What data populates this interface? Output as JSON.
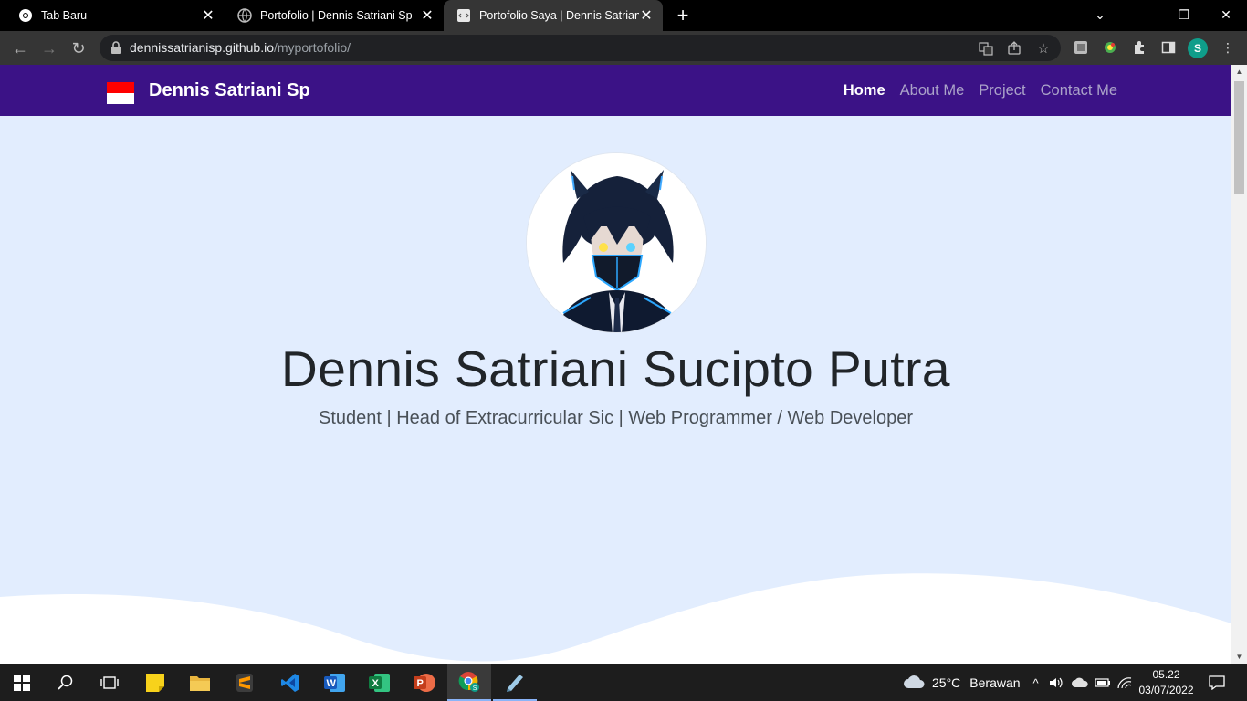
{
  "browser": {
    "tabs": [
      {
        "title": "Tab Baru",
        "icon": "chrome-icon",
        "active": false
      },
      {
        "title": "Portofolio | Dennis Satriani Sp",
        "icon": "globe-icon",
        "active": false
      },
      {
        "title": "Portofolio Saya | Dennis Satriani Sp",
        "icon": "page-icon",
        "active": true
      }
    ],
    "url_host": "dennissatrianisp.github.io",
    "url_path": "/myportofolio/",
    "profile_initial": "S"
  },
  "site": {
    "brand": "Dennis Satriani Sp",
    "nav": [
      {
        "label": "Home",
        "active": true
      },
      {
        "label": "About Me",
        "active": false
      },
      {
        "label": "Project",
        "active": false
      },
      {
        "label": "Contact Me",
        "active": false
      }
    ],
    "hero": {
      "name": "Dennis Satriani Sucipto Putra",
      "tagline": "Student | Head of Extracurricular Sic | Web Programmer / Web Developer"
    },
    "colors": {
      "navbar": "#3b1286",
      "hero_bg": "#e2edfe",
      "wave": "#ffffff"
    }
  },
  "taskbar": {
    "apps": [
      "windows-start",
      "search",
      "task-view",
      "sticky-notes",
      "file-explorer",
      "sublime-text",
      "vs-code",
      "word",
      "excel",
      "powerpoint",
      "chrome",
      "notepad"
    ],
    "weather_temp": "25°C",
    "weather_desc": "Berawan",
    "time": "05.22",
    "date": "03/07/2022"
  }
}
